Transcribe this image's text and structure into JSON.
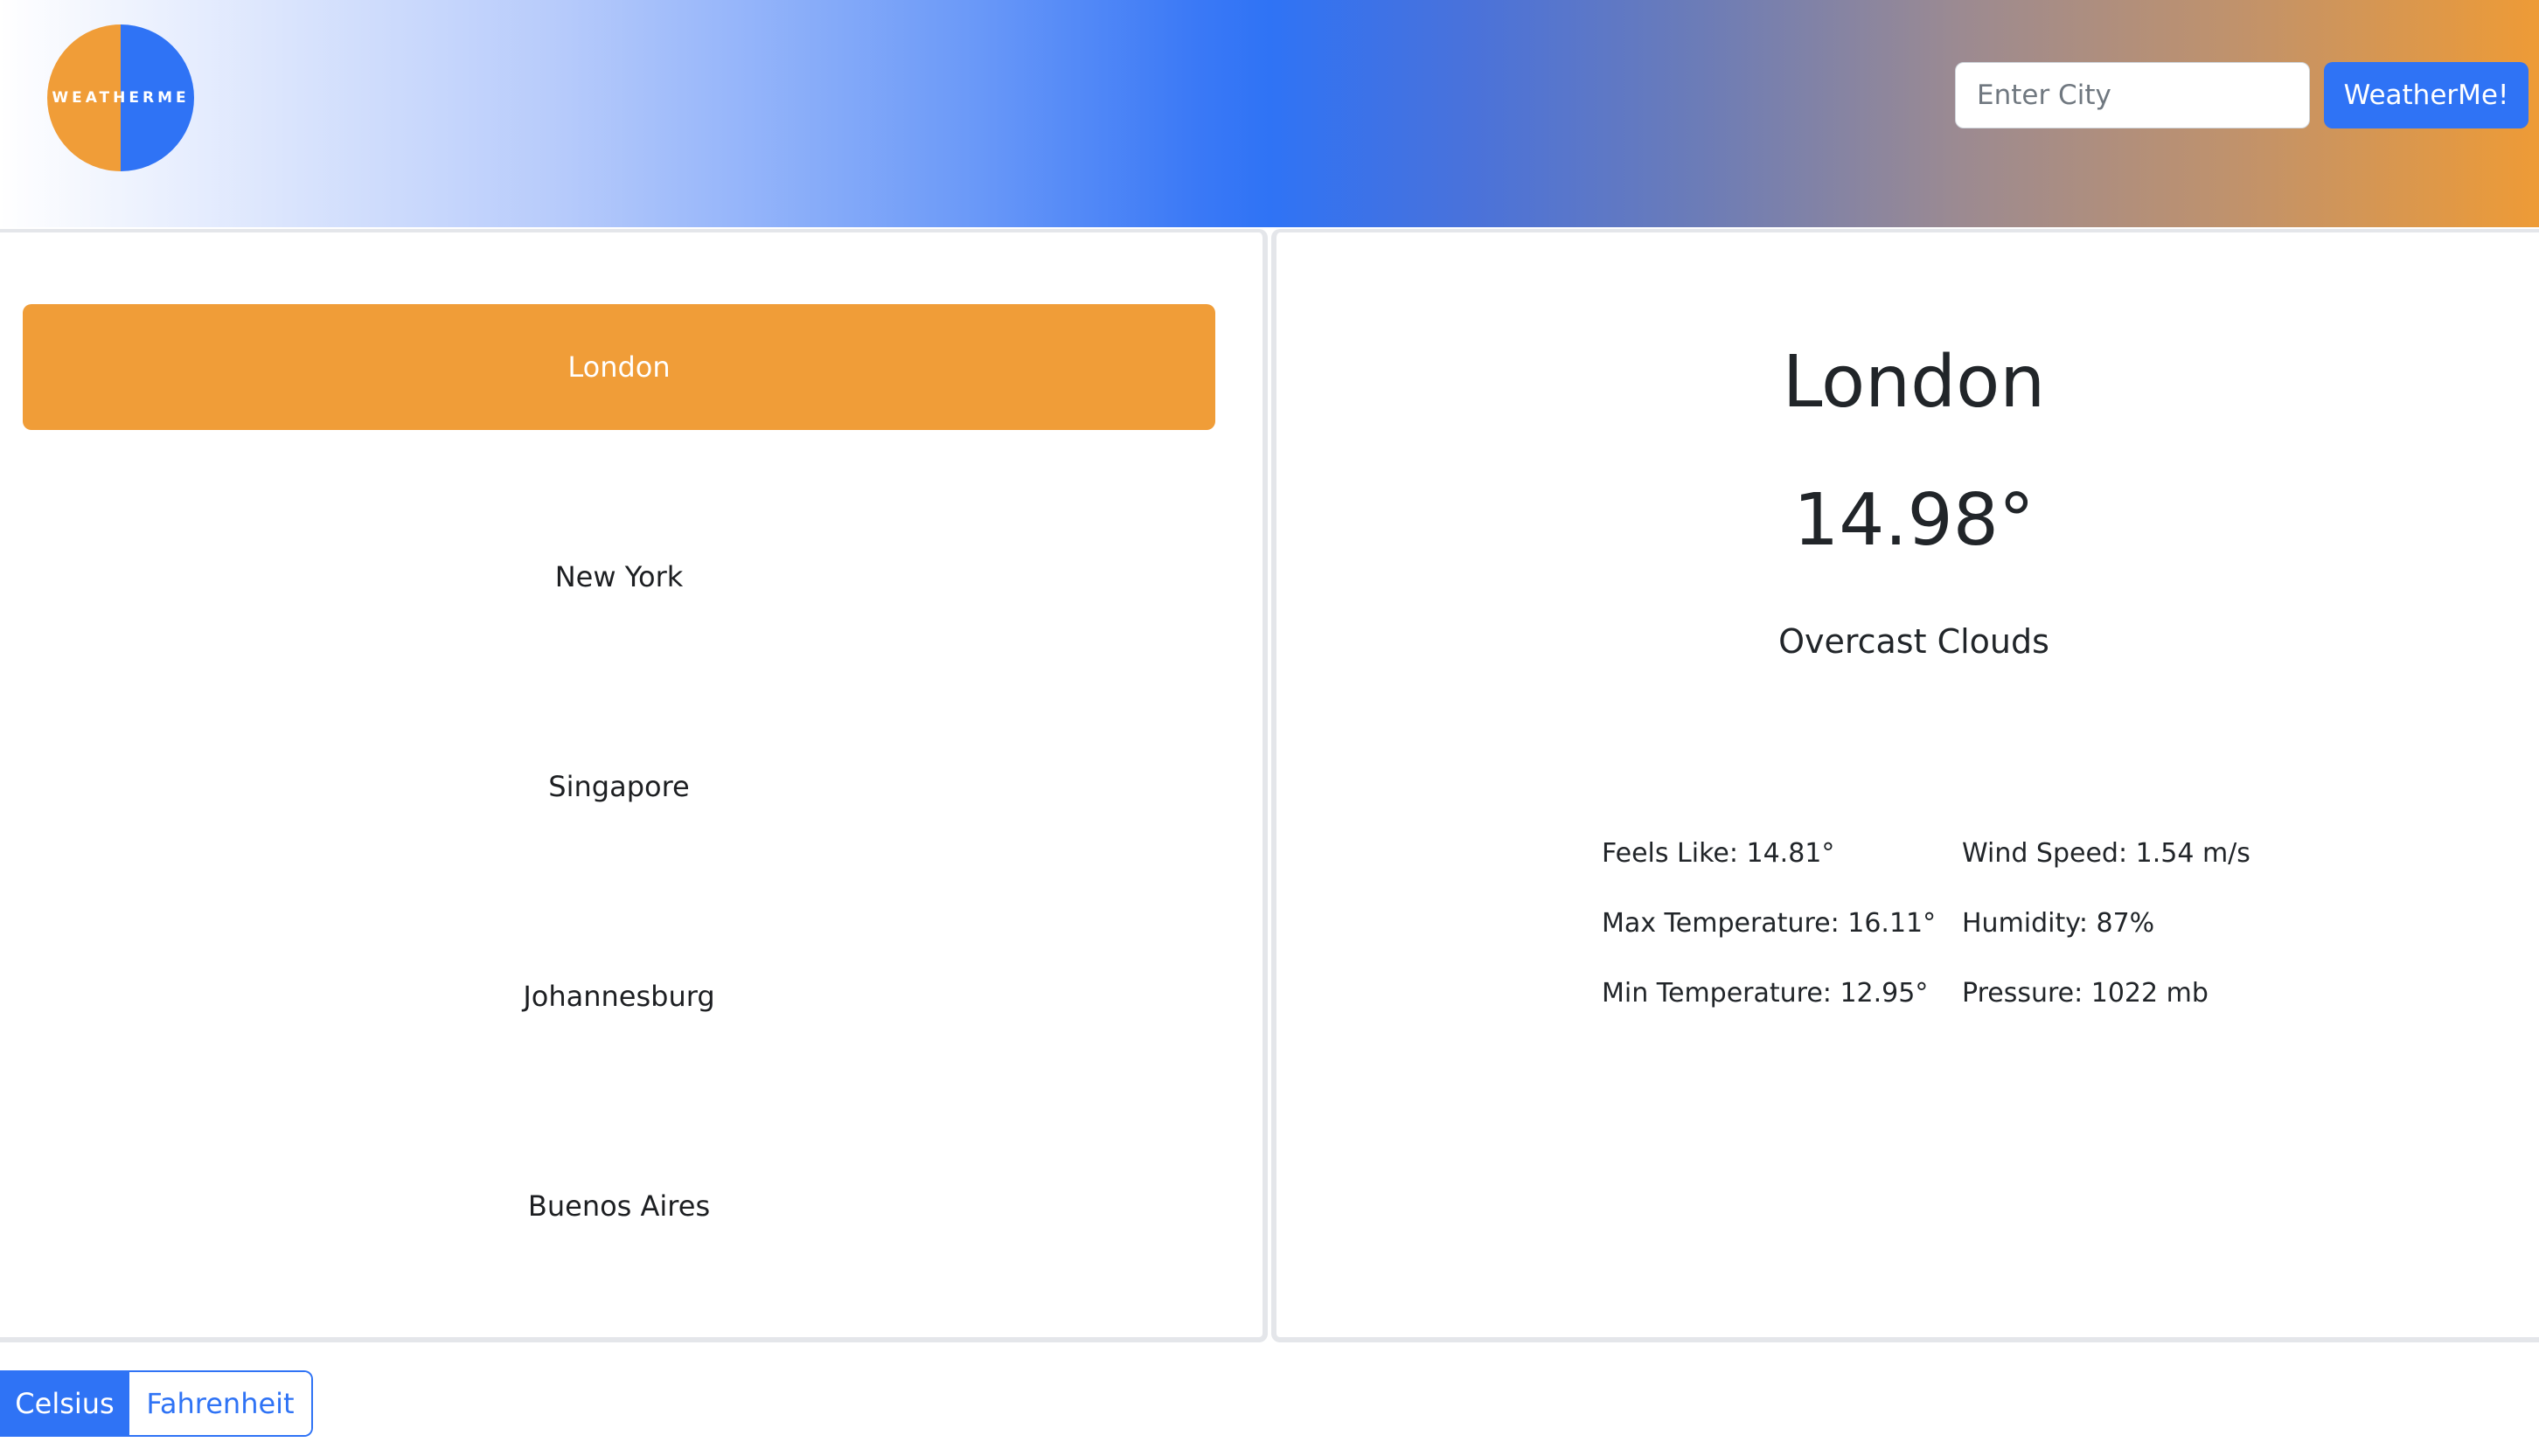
{
  "header": {
    "logo_text": "WEATHERME",
    "search": {
      "placeholder": "Enter City",
      "value": ""
    },
    "search_button_label": "WeatherMe!"
  },
  "cities": [
    {
      "label": "London",
      "active": true
    },
    {
      "label": "New York",
      "active": false
    },
    {
      "label": "Singapore",
      "active": false
    },
    {
      "label": "Johannesburg",
      "active": false
    },
    {
      "label": "Buenos Aires",
      "active": false
    }
  ],
  "weather": {
    "city": "London",
    "temperature": "14.98°",
    "condition": "Overcast Clouds",
    "stats": {
      "feels_like": "Feels Like: 14.81°",
      "wind_speed": "Wind Speed: 1.54 m/s",
      "max_temp": "Max Temperature: 16.11°",
      "humidity": "Humidity: 87%",
      "min_temp": "Min Temperature: 12.95°",
      "pressure": "Pressure: 1022 mb"
    }
  },
  "units": {
    "celsius_label": "Celsius",
    "fahrenheit_label": "Fahrenheit",
    "selected": "Celsius"
  },
  "colors": {
    "accent_blue": "#2f73f5",
    "accent_orange": "#f09d38"
  }
}
